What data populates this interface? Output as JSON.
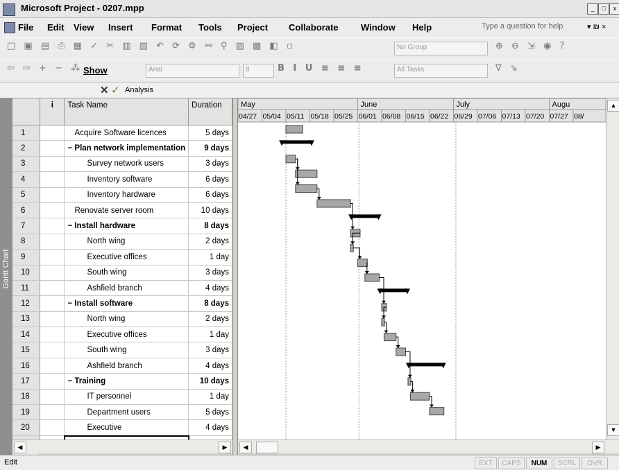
{
  "window": {
    "title": "Microsoft Project - 0207.mpp",
    "controls": [
      "_",
      "□",
      "x"
    ]
  },
  "menu": {
    "items": [
      "File",
      "Edit",
      "View",
      "Insert",
      "Format",
      "Tools",
      "Project",
      "Collaborate",
      "Window",
      "Help"
    ],
    "help_placeholder": "Type a question for help"
  },
  "toolbar1": {
    "group_select": "No Group"
  },
  "toolbar2": {
    "show_label": "Show",
    "font": "Arial",
    "size": "8",
    "filter": "All Tasks"
  },
  "entry_bar": {
    "value": "Analysis"
  },
  "sheet": {
    "headers": {
      "info": "i",
      "task_name": "Task Name",
      "duration": "Duration"
    },
    "rows": [
      {
        "id": "1",
        "name": "Acquire Software licences",
        "duration": "5 days",
        "summary": false,
        "level": 1
      },
      {
        "id": "2",
        "name": "Plan network implementation",
        "duration": "9 days",
        "summary": true,
        "level": 0
      },
      {
        "id": "3",
        "name": "Survey network users",
        "duration": "3 days",
        "summary": false,
        "level": 2
      },
      {
        "id": "4",
        "name": "Inventory software",
        "duration": "6 days",
        "summary": false,
        "level": 2
      },
      {
        "id": "5",
        "name": "Inventory hardware",
        "duration": "6 days",
        "summary": false,
        "level": 2
      },
      {
        "id": "6",
        "name": "Renovate server room",
        "duration": "10 days",
        "summary": false,
        "level": 1
      },
      {
        "id": "7",
        "name": "Install hardware",
        "duration": "8 days",
        "summary": true,
        "level": 0
      },
      {
        "id": "8",
        "name": "North wing",
        "duration": "2 days",
        "summary": false,
        "level": 2
      },
      {
        "id": "9",
        "name": "Executive offices",
        "duration": "1 day",
        "summary": false,
        "level": 2
      },
      {
        "id": "10",
        "name": "South wing",
        "duration": "3 days",
        "summary": false,
        "level": 2
      },
      {
        "id": "11",
        "name": "Ashfield branch",
        "duration": "4 days",
        "summary": false,
        "level": 2
      },
      {
        "id": "12",
        "name": "Install software",
        "duration": "8 days",
        "summary": true,
        "level": 0
      },
      {
        "id": "13",
        "name": "North wing",
        "duration": "2 days",
        "summary": false,
        "level": 2
      },
      {
        "id": "14",
        "name": "Executive offices",
        "duration": "1 day",
        "summary": false,
        "level": 2
      },
      {
        "id": "15",
        "name": "South wing",
        "duration": "3 days",
        "summary": false,
        "level": 2
      },
      {
        "id": "16",
        "name": "Ashfield branch",
        "duration": "4 days",
        "summary": false,
        "level": 2
      },
      {
        "id": "17",
        "name": "Training",
        "duration": "10 days",
        "summary": true,
        "level": 0
      },
      {
        "id": "18",
        "name": "IT personnel",
        "duration": "1 day",
        "summary": false,
        "level": 2
      },
      {
        "id": "19",
        "name": "Department users",
        "duration": "5 days",
        "summary": false,
        "level": 2
      },
      {
        "id": "20",
        "name": "Executive",
        "duration": "4 days",
        "summary": false,
        "level": 2
      }
    ],
    "editing_cell": "Analysis"
  },
  "side_label": "Gantt Chart",
  "gantt": {
    "months": [
      "May",
      "June",
      "July",
      "Augu"
    ],
    "weeks": [
      "04/27",
      "05/04",
      "05/11",
      "05/18",
      "05/25",
      "06/01",
      "06/08",
      "06/15",
      "06/22",
      "06/29",
      "07/06",
      "07/13",
      "07/20",
      "07/27",
      "08/"
    ],
    "bars": [
      {
        "row": 1,
        "start": 2.0,
        "end": 2.7,
        "type": "task"
      },
      {
        "row": 2,
        "start": 1.8,
        "end": 3.1,
        "type": "summary"
      },
      {
        "row": 3,
        "start": 2.0,
        "end": 2.4,
        "type": "task"
      },
      {
        "row": 4,
        "start": 2.4,
        "end": 3.3,
        "type": "task"
      },
      {
        "row": 5,
        "start": 2.4,
        "end": 3.3,
        "type": "task"
      },
      {
        "row": 6,
        "start": 3.3,
        "end": 4.7,
        "type": "task"
      },
      {
        "row": 7,
        "start": 4.7,
        "end": 5.9,
        "type": "summary"
      },
      {
        "row": 8,
        "start": 4.7,
        "end": 5.1,
        "type": "task"
      },
      {
        "row": 9,
        "start": 4.7,
        "end": 4.8,
        "type": "task"
      },
      {
        "row": 10,
        "start": 5.0,
        "end": 5.4,
        "type": "task"
      },
      {
        "row": 11,
        "start": 5.3,
        "end": 5.9,
        "type": "task"
      },
      {
        "row": 12,
        "start": 5.9,
        "end": 7.1,
        "type": "summary"
      },
      {
        "row": 13,
        "start": 6.0,
        "end": 6.2,
        "type": "task"
      },
      {
        "row": 14,
        "start": 6.0,
        "end": 6.1,
        "type": "task"
      },
      {
        "row": 15,
        "start": 6.1,
        "end": 6.6,
        "type": "task"
      },
      {
        "row": 16,
        "start": 6.6,
        "end": 7.0,
        "type": "task"
      },
      {
        "row": 17,
        "start": 7.1,
        "end": 8.6,
        "type": "summary"
      },
      {
        "row": 18,
        "start": 7.1,
        "end": 7.2,
        "type": "task"
      },
      {
        "row": 19,
        "start": 7.2,
        "end": 8.0,
        "type": "task"
      },
      {
        "row": 20,
        "start": 8.0,
        "end": 8.6,
        "type": "task"
      }
    ]
  },
  "status": {
    "mode": "Edit",
    "indicators": [
      {
        "label": "EXT",
        "active": false
      },
      {
        "label": "CAPS",
        "active": false
      },
      {
        "label": "NUM",
        "active": true
      },
      {
        "label": "SCRL",
        "active": false
      },
      {
        "label": "OVR",
        "active": false
      }
    ]
  }
}
